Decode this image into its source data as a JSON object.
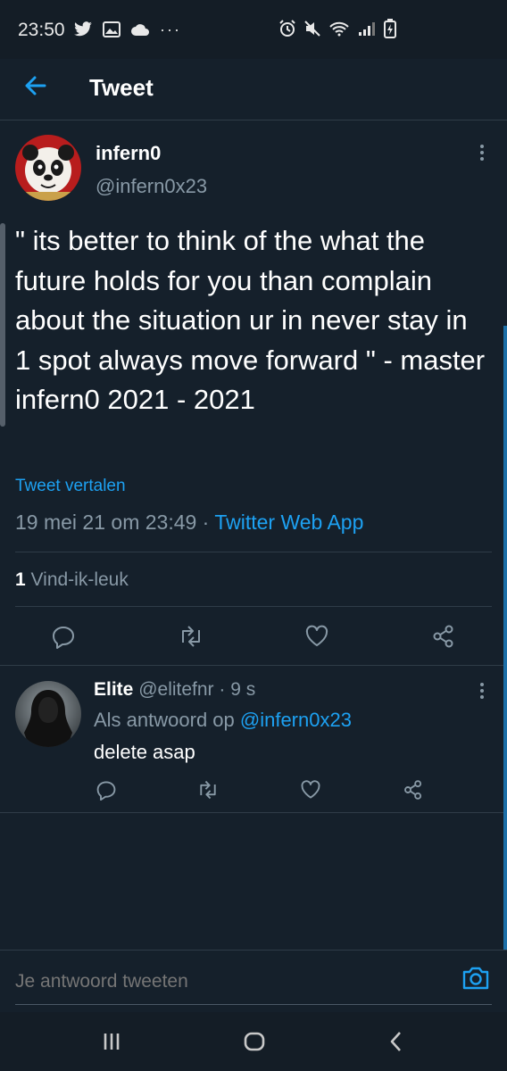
{
  "status_bar": {
    "time": "23:50",
    "left_icons": "🐦 ▣ ☁ ···",
    "right_icons": "⏰ 🔇 📶 ▮"
  },
  "header": {
    "title": "Tweet"
  },
  "tweet": {
    "author_name": "infern0",
    "author_handle": "@infern0x23",
    "text": "\" its better to think of the what the future holds for you than complain about the situation ur in never stay in 1 spot always move forward \" - master infern0 2021 - 2021",
    "translate_label": "Tweet vertalen",
    "timestamp": "19 mei 21 om 23:49",
    "separator": " · ",
    "source_app": "Twitter Web App",
    "like_count": "1",
    "like_label": "Vind-ik-leuk"
  },
  "reply": {
    "name": "Elite",
    "handle_time": "@elitefnr · 9 s",
    "reply_to_prefix": "Als antwoord op ",
    "reply_to_handle": "@infern0x23",
    "text": "delete asap"
  },
  "compose": {
    "placeholder": "Je antwoord tweeten"
  },
  "colors": {
    "background": "#15202b",
    "accent": "#1da1f2",
    "secondary_text": "#8899a6",
    "divider": "#2f3c48"
  }
}
